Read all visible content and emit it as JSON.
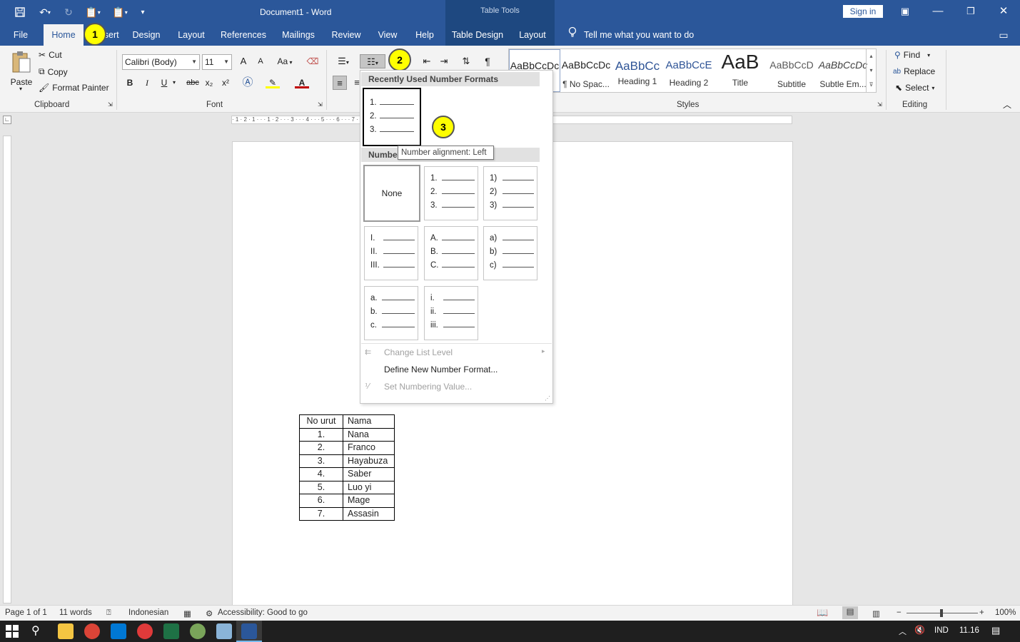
{
  "window": {
    "title": "Document1 - Word",
    "context_title": "Table Tools",
    "sign_in": "Sign in"
  },
  "tabs": [
    "File",
    "Home",
    "Insert",
    "Design",
    "Layout",
    "References",
    "Mailings",
    "Review",
    "View",
    "Help"
  ],
  "context_tabs": [
    "Table Design",
    "Layout"
  ],
  "tell_me": "Tell me what you want to do",
  "clipboard": {
    "paste": "Paste",
    "cut": "Cut",
    "copy": "Copy",
    "format_painter": "Format Painter",
    "label": "Clipboard"
  },
  "font": {
    "family": "Calibri (Body)",
    "size": "11",
    "label": "Font",
    "grow": "A",
    "shrink": "A",
    "case": "Aa",
    "bold": "B",
    "italic": "I",
    "underline": "U",
    "strike": "abc",
    "sub": "x₂",
    "sup": "x²",
    "fontcolor": "A"
  },
  "styles": {
    "label": "Styles",
    "items": [
      {
        "preview": "AaBbCcDc",
        "name": "¶ Normal",
        "color": "#000000"
      },
      {
        "preview": "AaBbCcDc",
        "name": "¶ No Spac...",
        "color": "#000000"
      },
      {
        "preview": "AaBbCc",
        "name": "Heading 1",
        "color": "#2f5496"
      },
      {
        "preview": "AaBbCcE",
        "name": "Heading 2",
        "color": "#2f5496"
      },
      {
        "preview": "AaB",
        "name": "Title",
        "color": "#000000"
      },
      {
        "preview": "AaBbCcD",
        "name": "Subtitle",
        "color": "#595959"
      },
      {
        "preview": "AaBbCcDc",
        "name": "Subtle Em...",
        "color": "#404040"
      }
    ]
  },
  "editing": {
    "find": "Find",
    "replace": "Replace",
    "select": "Select",
    "label": "Editing"
  },
  "callouts": [
    "1",
    "2",
    "3"
  ],
  "dropdown": {
    "recent_header": "Recently Used Number Formats",
    "library_header": "Numbering Library",
    "recent": [
      {
        "items": [
          "1.",
          "2.",
          "3."
        ]
      }
    ],
    "none_label": "None",
    "library": [
      {
        "items": [
          "1.",
          "2.",
          "3."
        ]
      },
      {
        "items": [
          "1)",
          "2)",
          "3)"
        ]
      },
      {
        "items": [
          "I.",
          "II.",
          "III."
        ]
      },
      {
        "items": [
          "A.",
          "B.",
          "C."
        ]
      },
      {
        "items": [
          "a)",
          "b)",
          "c)"
        ]
      },
      {
        "items": [
          "a.",
          "b.",
          "c."
        ]
      },
      {
        "items": [
          "i.",
          "ii.",
          "iii."
        ]
      }
    ],
    "change_level": "Change List Level",
    "define_new": "Define New Number Format...",
    "set_value": "Set Numbering Value..."
  },
  "tooltip": "Number alignment: Left",
  "ruler_marks": "· 1 · 2 · 1 · · · 1 · 2 · · · 3 · · · 4 · · · 5 · · · 6 · · · 7 · · · 8 · · · 9 · · · 10 · · · 11 · · · 12 · · · 13 · · · 14 · · · 15 · · · 16 · · · 17 · · · 18",
  "table": {
    "headers": [
      "No urut",
      "Nama"
    ],
    "rows": [
      [
        "1.",
        "Nana"
      ],
      [
        "2.",
        "Franco"
      ],
      [
        "3.",
        "Hayabuza"
      ],
      [
        "4.",
        "Saber"
      ],
      [
        "5.",
        "Luo yi"
      ],
      [
        "6.",
        "Mage"
      ],
      [
        "7.",
        "Assasin"
      ]
    ]
  },
  "status": {
    "page": "Page 1 of 1",
    "words": "11 words",
    "language": "Indonesian",
    "accessibility": "Accessibility: Good to go",
    "zoom": "100%"
  },
  "taskbar": {
    "lang": "IND",
    "time": "11.16"
  }
}
